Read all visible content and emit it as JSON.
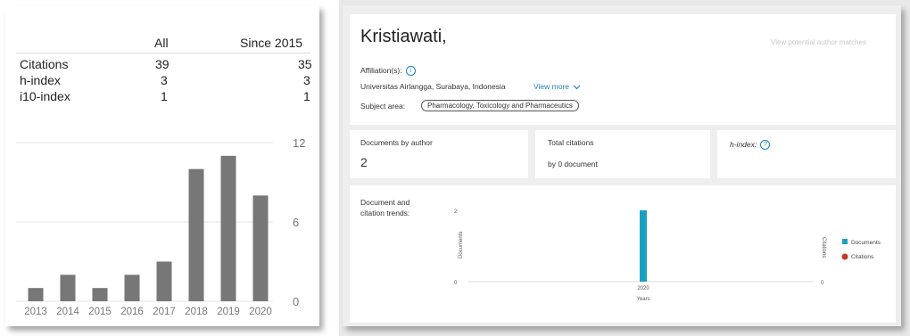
{
  "scholar": {
    "table": {
      "headers": [
        "",
        "All",
        "Since 2015"
      ],
      "rows": [
        {
          "label": "Citations",
          "all": "39",
          "since": "35"
        },
        {
          "label": "h-index",
          "all": "3",
          "since": "3"
        },
        {
          "label": "i10-index",
          "all": "1",
          "since": "1"
        }
      ]
    },
    "chart_data": {
      "type": "bar",
      "categories": [
        "2013",
        "2014",
        "2015",
        "2016",
        "2017",
        "2018",
        "2019",
        "2020"
      ],
      "values": [
        1,
        2,
        1,
        2,
        3,
        10,
        11,
        8
      ],
      "ylim": [
        0,
        12
      ],
      "yticks": [
        "12",
        "6",
        "0"
      ],
      "bar_color": "#777777",
      "grid": true
    }
  },
  "scopus": {
    "author_name": "Kristiawati,",
    "potential_matches_link": "View potential author matches",
    "affiliation_label": "Affiliation(s):",
    "affiliation_value": "Universitas Airlangga, Surabaya, Indonesia",
    "view_more": "View more",
    "subject_label": "Subject area:",
    "subject_value": "Pharmacology, Toxicology and Pharmaceutics",
    "metrics": {
      "documents_label": "Documents by author",
      "documents_value": "2",
      "citations_label": "Total citations",
      "citations_value": "by 0 document",
      "hindex_label": "h-index:"
    },
    "trend_label_line1": "Document and",
    "trend_label_line2": "citation trends:",
    "chart_data": {
      "type": "bar",
      "categories": [
        "2020"
      ],
      "series": [
        {
          "name": "Documents",
          "values": [
            2
          ],
          "color": "#1a9fc1"
        },
        {
          "name": "Citations",
          "values": [
            0
          ],
          "color": "#c0392b"
        }
      ],
      "xlabel": "Years",
      "ylabel": "Documents",
      "ylabel_right": "Citations",
      "y_tick_top": "2",
      "y_tick_bottom": "0",
      "y_right_tick_bottom": "0",
      "ylim": [
        0,
        2
      ],
      "legend": "right"
    }
  },
  "colors": {
    "accent": "#1f7fc2",
    "bar_gray": "#777777",
    "documents": "#1a9fc1",
    "citations": "#c0392b"
  }
}
